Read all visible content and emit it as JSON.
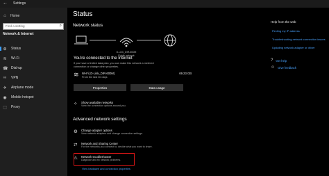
{
  "window": {
    "title": "Settings",
    "back_glyph": "←"
  },
  "sidebar": {
    "home": {
      "label": "Home",
      "icon": "home-icon",
      "glyph": "⌂"
    },
    "search": {
      "placeholder": "Find a setting",
      "icon": "search-icon",
      "glyph": "⌕"
    },
    "section_title": "Network & Internet",
    "items": [
      {
        "label": "Status",
        "icon": "globe-icon",
        "glyph": "⊕",
        "active": true
      },
      {
        "label": "Wi-Fi",
        "icon": "wifi-icon",
        "glyph": "≋",
        "active": false
      },
      {
        "label": "Dial-up",
        "icon": "phone-icon",
        "glyph": "☎",
        "active": false
      },
      {
        "label": "VPN",
        "icon": "vpn-icon",
        "glyph": "∞",
        "active": false
      },
      {
        "label": "Airplane mode",
        "icon": "airplane-icon",
        "glyph": "✈",
        "active": false
      },
      {
        "label": "Mobile hotspot",
        "icon": "hotspot-icon",
        "glyph": "◉",
        "active": false
      },
      {
        "label": "Proxy",
        "icon": "proxy-icon",
        "glyph": "⬚",
        "active": false
      }
    ]
  },
  "main": {
    "title": "Status",
    "network_status_heading": "Network status",
    "network_ssid": "D-Link_DIR-600M",
    "network_profile": "Public network",
    "connected_title": "You're connected to the Internet",
    "connected_desc": "If you have a limited data plan, you can make this network a metered connection or change other properties.",
    "wifi": {
      "name": "Wi-Fi (D-Link_DIR-600M)",
      "sub": "From the last 30 days",
      "usage": "69.23 GB"
    },
    "buttons": {
      "properties": "Properties",
      "data_usage": "Data usage"
    },
    "show_available": {
      "title": "Show available networks",
      "desc": "View the connection options around you."
    },
    "advanced_heading": "Advanced network settings",
    "advanced": [
      {
        "title": "Change adapter options",
        "desc": "View network adapters and change connection settings.",
        "icon": "adapter-icon",
        "glyph": "⚙"
      },
      {
        "title": "Network and Sharing Center",
        "desc": "For the networks you connect to, decide what you want to share.",
        "icon": "sharing-icon",
        "glyph": "⇄"
      },
      {
        "title": "Network troubleshooter",
        "desc": "Diagnose and fix network problems.",
        "icon": "warning-icon",
        "glyph": "⚠"
      }
    ],
    "bottom_link": "View hardware and connection properties"
  },
  "right_panel": {
    "title": "Help from the web",
    "links": [
      "Finding my IP address",
      "Troubleshooting network connection issues",
      "Updating network adapter or driver"
    ],
    "get_help": "Get help",
    "give_feedback": "Give feedback"
  },
  "colors": {
    "accent": "#3aa0ff",
    "link": "#4aa3ff",
    "highlight_box": "#d21515"
  }
}
